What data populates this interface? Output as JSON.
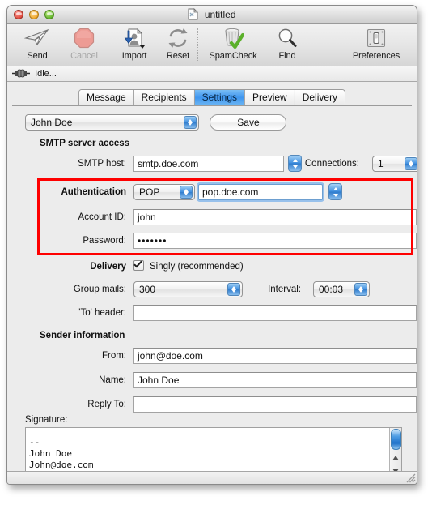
{
  "window": {
    "title": "untitled",
    "doc_icon": "document-icon",
    "traffic_lights": [
      "close-button",
      "minimize-button",
      "zoom-button"
    ]
  },
  "toolbar": {
    "items": [
      {
        "label": "Send",
        "icon": "paper-plane-icon",
        "enabled": true
      },
      {
        "label": "Cancel",
        "icon": "stop-octagon-icon",
        "enabled": false
      },
      {
        "label": "Import",
        "icon": "import-contact-icon",
        "enabled": true
      },
      {
        "label": "Reset",
        "icon": "refresh-arrows-icon",
        "enabled": true
      },
      {
        "label": "SpamCheck",
        "icon": "trash-check-icon",
        "enabled": true
      },
      {
        "label": "Find",
        "icon": "magnifier-icon",
        "enabled": true
      },
      {
        "label": "Preferences",
        "icon": "light-switch-icon",
        "enabled": true
      }
    ]
  },
  "status": {
    "icon": "plug-connector-icon",
    "text": "Idle..."
  },
  "tabs": [
    {
      "label": "Message",
      "active": false
    },
    {
      "label": "Recipients",
      "active": false
    },
    {
      "label": "Settings",
      "active": true
    },
    {
      "label": "Preview",
      "active": false
    },
    {
      "label": "Delivery",
      "active": false
    }
  ],
  "profile": {
    "selected": "John Doe",
    "save_label": "Save"
  },
  "smtp_section": {
    "heading": "SMTP server access",
    "host_label": "SMTP host:",
    "host_value": "smtp.doe.com",
    "connections_label": "Connections:",
    "connections_value": "1",
    "auth_label": "Authentication",
    "auth_type": "POP",
    "auth_server": "pop.doe.com",
    "account_label": "Account ID:",
    "account_value": "john",
    "password_label": "Password:",
    "password_value": "•••••••"
  },
  "delivery_section": {
    "label": "Delivery",
    "singly_label": "Singly (recommended)",
    "singly_checked": true,
    "group_label": "Group mails:",
    "group_value": "300",
    "interval_label": "Interval:",
    "interval_value": "00:03",
    "to_header_label": "'To' header:",
    "to_header_value": ""
  },
  "sender_section": {
    "heading": "Sender information",
    "from_label": "From:",
    "from_value": "john@doe.com",
    "name_label": "Name:",
    "name_value": "John  Doe",
    "replyto_label": "Reply To:",
    "replyto_value": ""
  },
  "signature": {
    "label": "Signature:",
    "text": "--\nJohn Doe\nJohn@doe.com"
  },
  "annotation": {
    "highlight_color": "#fe0000",
    "highlight_target": "authentication-group"
  }
}
